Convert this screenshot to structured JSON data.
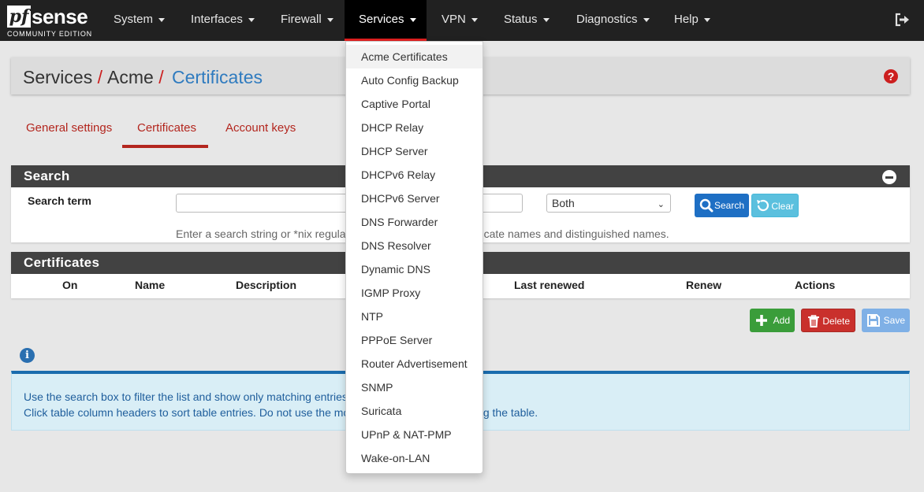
{
  "brand": {
    "logo_pf": "pf",
    "logo_sense": "sense",
    "edition": "COMMUNITY EDITION"
  },
  "nav": {
    "items": [
      {
        "label": "System"
      },
      {
        "label": "Interfaces"
      },
      {
        "label": "Firewall"
      },
      {
        "label": "Services",
        "active": true
      },
      {
        "label": "VPN"
      },
      {
        "label": "Status"
      },
      {
        "label": "Diagnostics"
      },
      {
        "label": "Help"
      }
    ],
    "logout_icon": "logout-icon"
  },
  "breadcrumb": {
    "parts": [
      "Services",
      "Acme",
      "Certificates"
    ],
    "separator": "/",
    "help_icon": "question-circle-icon"
  },
  "tabs": [
    {
      "label": "General settings"
    },
    {
      "label": "Certificates",
      "active": true
    },
    {
      "label": "Account keys"
    }
  ],
  "search_panel": {
    "title": "Search",
    "term_label": "Search term",
    "search_value": "",
    "scope_selected": "Both",
    "search_button": "Search",
    "clear_button": "Clear",
    "help": "Enter a search string or *nix regular expression to search certificate names and distinguished names."
  },
  "certificates_panel": {
    "title": "Certificates",
    "columns": [
      "On",
      "Name",
      "Description",
      "Last renewed",
      "Renew",
      "Actions"
    ]
  },
  "buttons": {
    "add": "Add",
    "delete": "Delete",
    "save": "Save"
  },
  "info": {
    "line1": "Use the search box to filter the list and show only matching entries.",
    "line2": "Click table column headers to sort table entries. Do not use the move/drag function after sorting the table."
  },
  "services_menu": [
    "Acme Certificates",
    "Auto Config Backup",
    "Captive Portal",
    "DHCP Relay",
    "DHCP Server",
    "DHCPv6 Relay",
    "DHCPv6 Server",
    "DNS Forwarder",
    "DNS Resolver",
    "Dynamic DNS",
    "IGMP Proxy",
    "NTP",
    "PPPoE Server",
    "Router Advertisement",
    "SNMP",
    "Suricata",
    "UPnP & NAT-PMP",
    "Wake-on-LAN"
  ],
  "colors": {
    "brand_red": "#b3261e",
    "navbar": "#212121",
    "link_blue": "#2f7bbf",
    "panel_head": "#424242"
  }
}
